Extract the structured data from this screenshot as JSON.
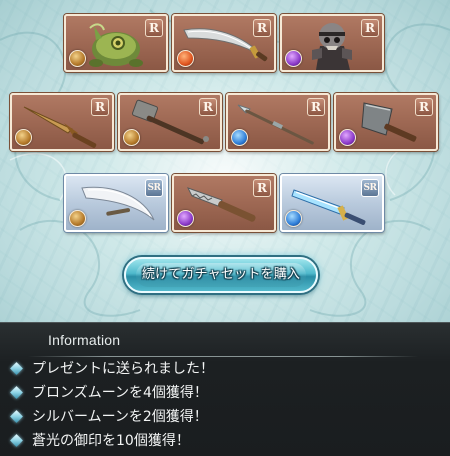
{
  "items": [
    {
      "name": "Frog creature summon",
      "rarity": "R",
      "element": "earth",
      "icon": "frog-creature-icon"
    },
    {
      "name": "Curved scimitar",
      "rarity": "R",
      "element": "fire",
      "icon": "scimitar-icon"
    },
    {
      "name": "Armored skeleton summon",
      "rarity": "R",
      "element": "dark",
      "icon": "skeleton-knight-icon"
    },
    {
      "name": "Bronze dagger",
      "rarity": "R",
      "element": "earth",
      "icon": "dagger-icon"
    },
    {
      "name": "War hammer",
      "rarity": "R",
      "element": "earth",
      "icon": "hammer-icon"
    },
    {
      "name": "Long spear",
      "rarity": "R",
      "element": "water",
      "icon": "spear-icon"
    },
    {
      "name": "Cleaver axe",
      "rarity": "R",
      "element": "dark",
      "icon": "cleaver-icon"
    },
    {
      "name": "Silver crescent blade",
      "rarity": "SR",
      "element": "earth",
      "icon": "crescent-blade-icon"
    },
    {
      "name": "Serrated knife",
      "rarity": "R",
      "element": "dark",
      "icon": "knife-icon"
    },
    {
      "name": "Crystal sword",
      "rarity": "SR",
      "element": "water",
      "icon": "crystal-sword-icon"
    }
  ],
  "buy_button": {
    "label": "続けてガチャセットを購入"
  },
  "information": {
    "title": "Information",
    "lines": [
      "プレゼントに送られました！",
      "ブロンズムーンを4個獲得！",
      "シルバームーンを2個獲得！",
      "蒼光の御印を10個獲得！"
    ]
  },
  "colors": {
    "r_card": "#a06a55",
    "sr_card": "#b9cadd",
    "button": "#4fb9cc",
    "panel": "#1c2022"
  }
}
